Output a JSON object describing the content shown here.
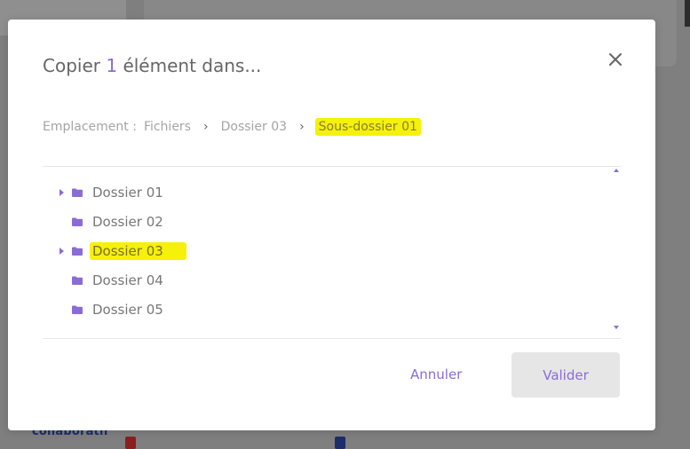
{
  "modal": {
    "title_prefix": "Copier",
    "count": "1",
    "title_suffix": "élément dans...",
    "close_icon": "close-icon"
  },
  "breadcrumb": {
    "label": "Emplacement :",
    "items": [
      "Fichiers",
      "Dossier 03"
    ],
    "current": "Sous-dossier 01",
    "separator": "›"
  },
  "tree": {
    "items": [
      {
        "label": "Dossier 01",
        "expandable": true
      },
      {
        "label": "Dossier 02",
        "expandable": false
      },
      {
        "label": "Dossier 03",
        "expandable": true,
        "highlighted": true
      },
      {
        "label": "Dossier 04",
        "expandable": false
      },
      {
        "label": "Dossier 05",
        "expandable": false
      }
    ]
  },
  "actions": {
    "cancel_label": "Annuler",
    "validate_label": "Valider"
  },
  "background": {
    "collab_text": "collaboratif"
  },
  "colors": {
    "accent": "#8a6cd6",
    "highlight": "#f5f10a",
    "folder": "#8a6cd6"
  }
}
